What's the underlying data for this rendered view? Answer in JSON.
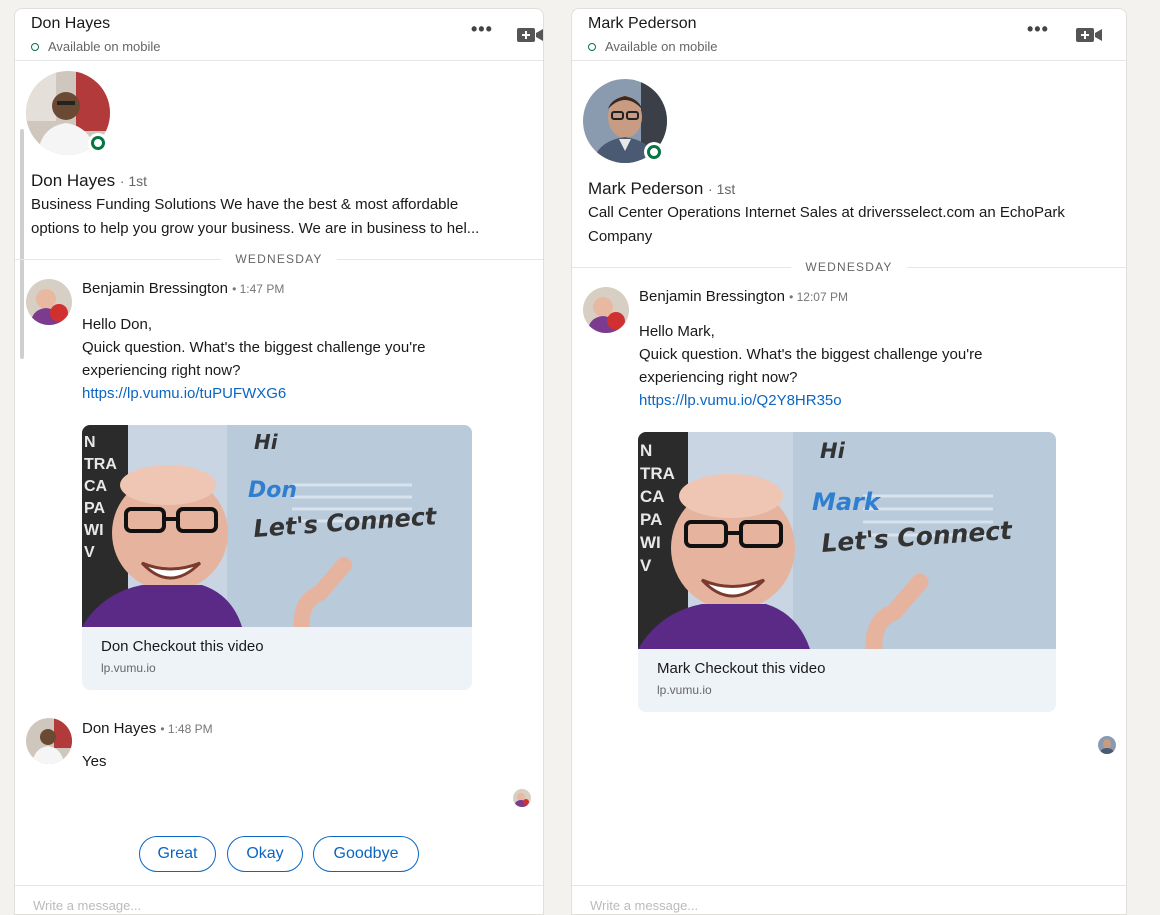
{
  "left": {
    "header": {
      "name": "Don Hayes",
      "status": "Available on mobile"
    },
    "profile": {
      "name": "Don Hayes",
      "degree": "· 1st",
      "headline_line1": "Business Funding Solutions We have the best & most affordable",
      "headline_line2": "options to help you grow your business. We are in business to hel..."
    },
    "day_divider": "WEDNESDAY",
    "messages": [
      {
        "sender": "Benjamin Bressington",
        "time": "• 1:47 PM",
        "lines": [
          "Hello Don,",
          "Quick question. What's the biggest challenge you're",
          "experiencing right now?"
        ],
        "link": "https://lp.vumu.io/tuPUFWXG6",
        "card": {
          "hi": "Hi",
          "first_name": "Don",
          "cta": "Let's Connect",
          "title": "Don Checkout this video",
          "domain": "lp.vumu.io"
        }
      },
      {
        "sender": "Don Hayes",
        "time": "• 1:48 PM",
        "text": "Yes"
      }
    ],
    "quick_replies": [
      "Great",
      "Okay",
      "Goodbye"
    ],
    "composer_placeholder": "Write a message..."
  },
  "right": {
    "header": {
      "name": "Mark Pederson",
      "status": "Available on mobile"
    },
    "profile": {
      "name": "Mark Pederson",
      "degree": "· 1st",
      "headline_line1": "Call Center Operations Internet Sales at driversselect.com an EchoPark",
      "headline_line2": "Company"
    },
    "day_divider": "WEDNESDAY",
    "messages": [
      {
        "sender": "Benjamin Bressington",
        "time": "• 12:07 PM",
        "lines": [
          "Hello Mark,",
          "Quick question. What's the biggest challenge you're",
          "experiencing right now?"
        ],
        "link": "https://lp.vumu.io/Q2Y8HR35o",
        "card": {
          "hi": "Hi",
          "first_name": "Mark",
          "cta": "Let's Connect",
          "title": "Mark Checkout this video",
          "domain": "lp.vumu.io"
        }
      }
    ],
    "composer_placeholder": "Write a message..."
  },
  "colors": {
    "link": "#0a66c2",
    "online": "#057642",
    "card_bg": "#eef3f8"
  },
  "icons": [
    "more-icon",
    "video-call-icon",
    "online-indicator-icon"
  ]
}
